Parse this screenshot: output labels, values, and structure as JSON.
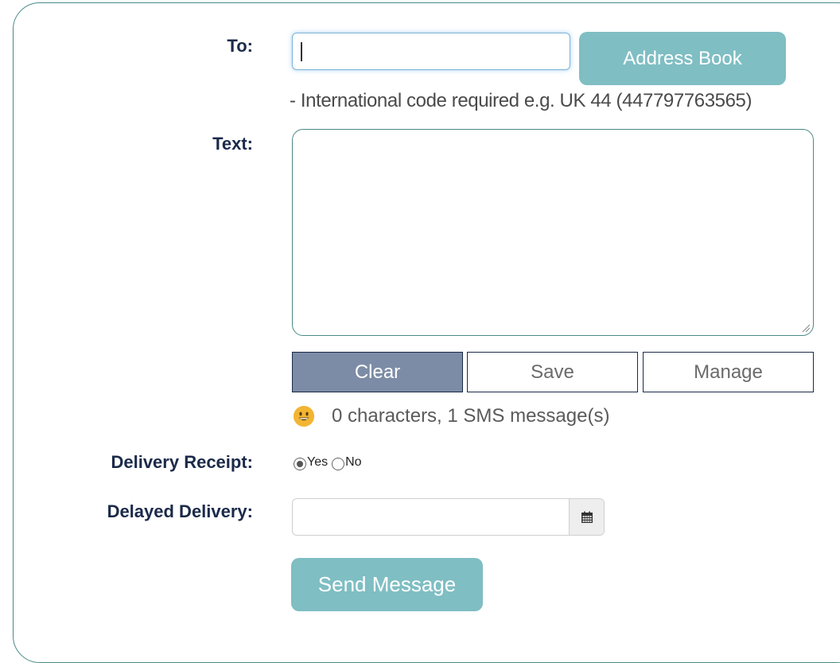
{
  "form": {
    "to": {
      "label": "To:",
      "value": "",
      "address_book_label": "Address Book",
      "hint": "- International code required e.g. UK 44 (447797763565)"
    },
    "text": {
      "label": "Text:",
      "value": ""
    },
    "actions": {
      "clear_label": "Clear",
      "save_label": "Save",
      "manage_label": "Manage"
    },
    "counter": {
      "emoji_icon": "smiley-face-icon",
      "text": "0 characters, 1 SMS message(s)"
    },
    "delivery_receipt": {
      "label": "Delivery Receipt:",
      "options": [
        {
          "label": "Yes",
          "checked": true
        },
        {
          "label": "No",
          "checked": false
        }
      ]
    },
    "delayed_delivery": {
      "label": "Delayed Delivery:",
      "value": "",
      "calendar_icon": "calendar-icon"
    },
    "send_label": "Send Message"
  },
  "colors": {
    "teal_button": "#7fbec3",
    "navy_text": "#1b2a4a",
    "clear_button": "#7d8ca6",
    "panel_border": "#4a8a86"
  }
}
